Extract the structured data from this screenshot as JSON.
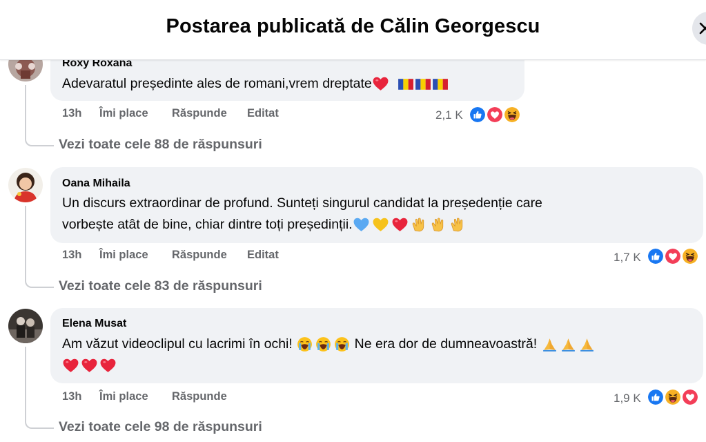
{
  "header": {
    "title": "Postarea publicată de Călin Georgescu"
  },
  "comments": [
    {
      "author": "Roxy Roxana",
      "text_lines": [
        "Adevaratul președinte ales de romani,vrem dreptate"
      ],
      "time": "13h",
      "like": "Îmi place",
      "reply": "Răspunde",
      "edited": "Editat",
      "reaction_count": "2,1 K",
      "reactions": [
        "like",
        "love",
        "haha"
      ],
      "view_replies": "Vezi toate cele 88 de răspunsuri"
    },
    {
      "author": "Oana Mihaila",
      "text_lines": [
        "Un discurs extraordinar de profund. Sunteți singurul candidat la președenție care",
        "vorbește atât de bine, chiar dintre toți președinții."
      ],
      "time": "13h",
      "like": "Îmi place",
      "reply": "Răspunde",
      "edited": "Editat",
      "reaction_count": "1,7 K",
      "reactions": [
        "like",
        "love",
        "haha"
      ],
      "view_replies": "Vezi toate cele 83 de răspunsuri"
    },
    {
      "author": "Elena Musat",
      "text_lines": [
        "Am văzut videoclipul cu lacrimi în ochi!",
        "Ne era dor de dumneavoastră!"
      ],
      "time": "13h",
      "like": "Îmi place",
      "reply": "Răspunde",
      "reaction_count": "1,9 K",
      "reactions": [
        "like",
        "haha",
        "love"
      ],
      "view_replies": "Vezi toate cele 98 de răspunsuri"
    }
  ],
  "colors": {
    "like": "#1877f2",
    "love": "#f33e58",
    "haha": "#f7b125",
    "secondary_text": "#65676b",
    "bubble": "#f0f2f5"
  }
}
